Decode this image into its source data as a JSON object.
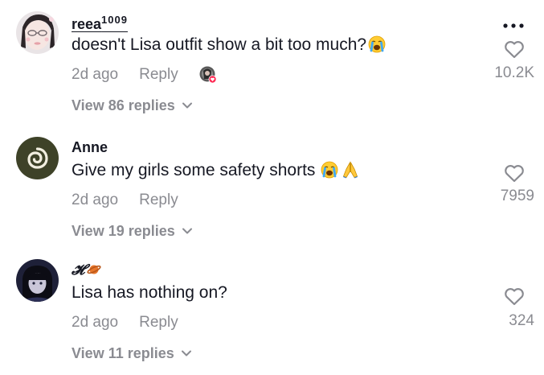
{
  "comments": [
    {
      "username": "reea",
      "username_suffix": "1009",
      "text": "doesn't Lisa outfit show a bit too much?",
      "emojis": [
        "crying-face"
      ],
      "time": "2d ago",
      "reply_label": "Reply",
      "view_replies": "View 86 replies",
      "likes": "10.2K",
      "creator_liked": true
    },
    {
      "username": "Anne",
      "text": "Give my girls some safety shorts",
      "emojis": [
        "crying-face",
        "folded-hands"
      ],
      "time": "2d ago",
      "reply_label": "Reply",
      "view_replies": "View 19 replies",
      "likes": "7959"
    },
    {
      "username": "𝓗",
      "username_emoji": "ringed-planet",
      "text": "Lisa has nothing on?",
      "time": "2d ago",
      "reply_label": "Reply",
      "view_replies": "View 11 replies",
      "likes": "324"
    }
  ],
  "colors": {
    "primary_text": "#161823",
    "secondary_text": "#8a8b91",
    "liked_badge": "#fe2c55"
  }
}
